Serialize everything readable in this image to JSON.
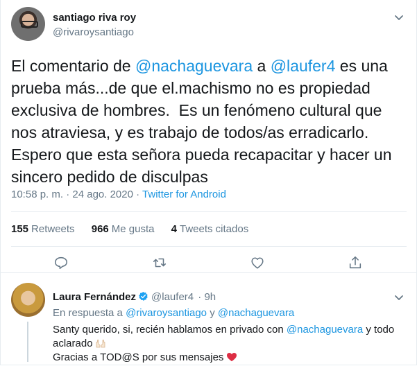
{
  "tweet": {
    "author_name": "santiago riva roy",
    "author_handle": "@rivaroysantiago",
    "text_parts": [
      "El comentario de ",
      "@nachaguevara",
      " a ",
      "@laufer4",
      " es una prueba más...de que el.machismo no es propiedad exclusiva de hombres.  Es un fenómeno cultural que nos atraviesa, y es trabajo de todos/as erradicarlo. Espero que esta señora pueda recapacitar y hacer un sincero pedido de disculpas"
    ],
    "timestamp": "10:58 p. m. · 24 ago. 2020 · ",
    "source": "Twitter for Android",
    "retweets_count": "155",
    "retweets_label": "Retweets",
    "likes_count": "966",
    "likes_label": "Me gusta",
    "quotes_count": "4",
    "quotes_label": "Tweets citados"
  },
  "reply": {
    "author_name": "Laura Fernández",
    "author_handle": "@laufer4",
    "time": "· 9h",
    "reply_prefix": "En respuesta a ",
    "reply_mention1": "@rivaroysantiago",
    "reply_and": " y ",
    "reply_mention2": "@nachaguevara",
    "text_part1": "Santy querido, si, recién hablamos en privado con ",
    "text_mention": "@nachaguevara",
    "text_part2": " y todo aclarado",
    "text_line2": "Gracias a TOD@S por sus mensajes"
  },
  "colors": {
    "accent": "#1b95e0",
    "muted": "#657786",
    "heart": "#e0245e"
  },
  "icons": [
    "chevron-down-icon",
    "reply-icon",
    "retweet-icon",
    "like-icon",
    "share-icon",
    "verified-badge-icon",
    "raising-hands-emoji",
    "red-heart-emoji"
  ]
}
